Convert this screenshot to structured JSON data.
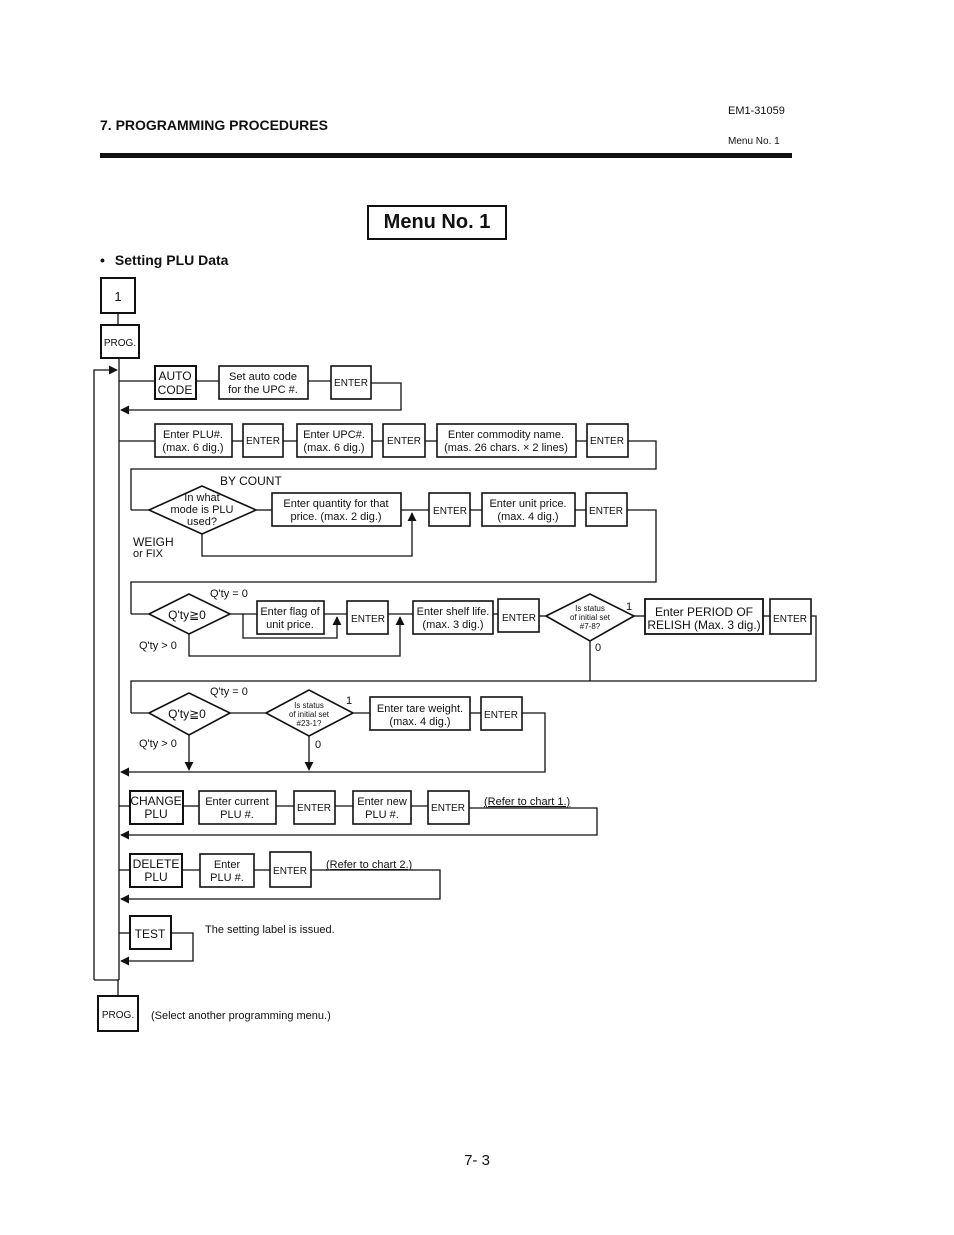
{
  "header": {
    "section_title": "7. PROGRAMMING PROCEDURES",
    "doc_code": "EM1-31059",
    "menu_ref": "Menu No. 1"
  },
  "menu_title": "Menu No. 1",
  "section": {
    "bullet": "•",
    "title": "Setting PLU Data"
  },
  "flow": {
    "start_key": "1",
    "prog_key": "PROG.",
    "auto_code": {
      "key_l1": "AUTO",
      "key_l2": "CODE",
      "step_l1": "Set auto code",
      "step_l2": "for the UPC #.",
      "enter": "ENTER"
    },
    "plu_row": {
      "plu_l1": "Enter PLU#.",
      "plu_l2": "(max. 6 dig.)",
      "upc_l1": "Enter UPC#.",
      "upc_l2": "(max. 6 dig.)",
      "name_l1": "Enter commodity name.",
      "name_l2": "(mas. 26 chars. × 2 lines)",
      "enter": "ENTER"
    },
    "mode_row": {
      "decision_l1": "In what",
      "decision_l2": "mode is PLU",
      "decision_l3": "used?",
      "by_count": "BY COUNT",
      "weigh_l1": "WEIGH",
      "weigh_l2": "or FIX",
      "qty_l1": "Enter quantity for that",
      "qty_l2": "price.  (max. 2 dig.)",
      "price_l1": "Enter unit price.",
      "price_l2": "(max. 4 dig.)",
      "enter": "ENTER"
    },
    "flag_row": {
      "decision": "Q'ty≧0",
      "eq_label": "Q'ty = 0",
      "gt_label": "Q'ty > 0",
      "flag_l1": "Enter flag of",
      "flag_l2": "unit price.",
      "shelf_l1": "Enter shelf life.",
      "shelf_l2": "(max. 3 dig.)",
      "status_l1": "Is status",
      "status_l2": "of initial set",
      "status_l3": "#7-8?",
      "yes": "1",
      "no": "0",
      "period_l1": "Enter PERIOD OF",
      "period_l2": "RELISH  (Max. 3 dig.)",
      "enter": "ENTER"
    },
    "tare_row": {
      "decision": "Q'ty≧0",
      "eq_label": "Q'ty = 0",
      "gt_label": "Q'ty > 0",
      "status_l1": "Is status",
      "status_l2": "of initial set",
      "status_l3": "#23-1?",
      "yes": "1",
      "no": "0",
      "tare_l1": "Enter tare weight.",
      "tare_l2": "(max. 4 dig.)",
      "enter": "ENTER"
    },
    "change_row": {
      "key_l1": "CHANGE",
      "key_l2": "PLU",
      "cur_l1": "Enter current",
      "cur_l2": "PLU #.",
      "new_l1": "Enter new",
      "new_l2": "PLU #.",
      "enter": "ENTER",
      "note": "(Refer to chart 1.)"
    },
    "delete_row": {
      "key_l1": "DELETE",
      "key_l2": "PLU",
      "plu_l1": "Enter",
      "plu_l2": "PLU #.",
      "enter": "ENTER",
      "note": "(Refer to chart 2.)"
    },
    "test_row": {
      "key": "TEST",
      "note": "The setting label is issued."
    },
    "end": {
      "prog_key": "PROG.",
      "note": "(Select another programming menu.)"
    }
  },
  "footer": {
    "page_number": "7- 3"
  }
}
